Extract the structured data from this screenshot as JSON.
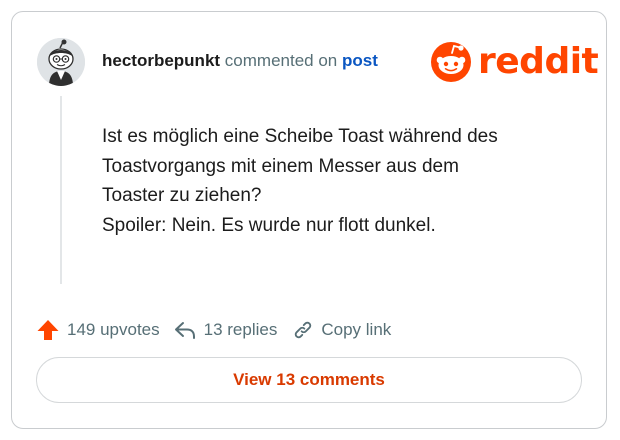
{
  "header": {
    "username": "hectorbepunkt",
    "action_text": "commented on",
    "link_text": "post"
  },
  "brand": {
    "logo_text": "reddit",
    "color": "#ff4500"
  },
  "comment": {
    "lines": [
      "Ist es möglich eine Scheibe Toast während des",
      "Toastvorgangs mit einem Messer aus dem",
      "Toaster zu ziehen?",
      "Spoiler: Nein. Es wurde nur flott dunkel."
    ]
  },
  "actions": {
    "upvotes": "149 upvotes",
    "replies": "13 replies",
    "copy_link": "Copy link"
  },
  "cta": {
    "label": "View 13 comments"
  },
  "icons": {
    "upvote": "upvote-arrow-icon",
    "reply": "reply-arrow-icon",
    "link": "link-icon",
    "logo": "reddit-snoo-icon"
  },
  "colors": {
    "accent": "#ff4500",
    "cta_text": "#d93a00",
    "link": "#0a56c2",
    "muted": "#576f76"
  }
}
